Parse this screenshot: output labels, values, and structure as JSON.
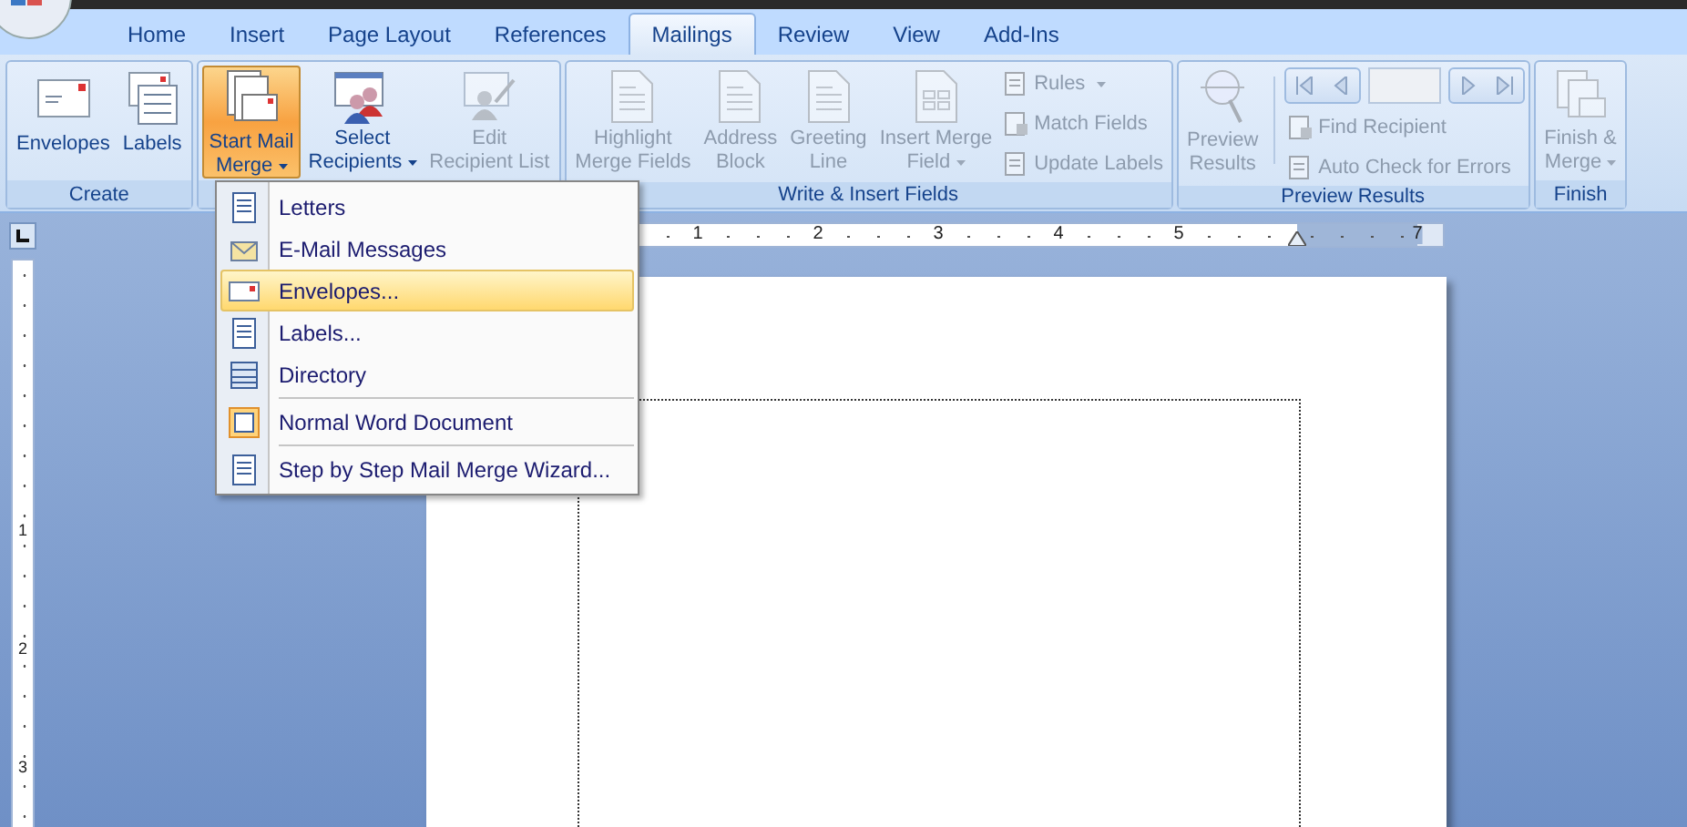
{
  "tabs": [
    {
      "label": "Home",
      "selected": false
    },
    {
      "label": "Insert",
      "selected": false
    },
    {
      "label": "Page Layout",
      "selected": false
    },
    {
      "label": "References",
      "selected": false
    },
    {
      "label": "Mailings",
      "selected": true
    },
    {
      "label": "Review",
      "selected": false
    },
    {
      "label": "View",
      "selected": false
    },
    {
      "label": "Add-Ins",
      "selected": false
    }
  ],
  "ribbon": {
    "groups": [
      {
        "label": "Create",
        "items": [
          {
            "kind": "large",
            "lines": [
              "Envelopes"
            ],
            "disabled": false,
            "pressed": false,
            "dropdown": false
          },
          {
            "kind": "large",
            "lines": [
              "Labels"
            ],
            "disabled": false,
            "pressed": false,
            "dropdown": false
          }
        ]
      },
      {
        "items": [
          {
            "kind": "large",
            "lines": [
              "Start Mail",
              "Merge"
            ],
            "disabled": false,
            "pressed": true,
            "dropdown": true
          },
          {
            "kind": "large",
            "lines": [
              "Select",
              "Recipients"
            ],
            "disabled": false,
            "pressed": false,
            "dropdown": true
          },
          {
            "kind": "large",
            "lines": [
              "Edit",
              "Recipient List"
            ],
            "disabled": true,
            "pressed": false,
            "dropdown": false
          }
        ]
      },
      {
        "label": "Write & Insert Fields",
        "items": [
          {
            "kind": "large",
            "lines": [
              "Highlight",
              "Merge Fields"
            ],
            "disabled": true,
            "pressed": false,
            "dropdown": false
          },
          {
            "kind": "large",
            "lines": [
              "Address",
              "Block"
            ],
            "disabled": true,
            "pressed": false,
            "dropdown": false
          },
          {
            "kind": "large",
            "lines": [
              "Greeting",
              "Line"
            ],
            "disabled": true,
            "pressed": false,
            "dropdown": false
          },
          {
            "kind": "large",
            "lines": [
              "Insert Merge",
              "Field"
            ],
            "disabled": true,
            "pressed": false,
            "dropdown": true
          },
          {
            "kind": "small",
            "labels": [
              "Rules",
              "Match Fields",
              "Update Labels"
            ],
            "dropdowns": [
              true,
              false,
              false
            ],
            "disabled": true
          }
        ]
      },
      {
        "label": "Preview Results",
        "items": [
          {
            "kind": "large",
            "lines": [
              "Preview",
              "Results"
            ],
            "disabled": true,
            "pressed": false,
            "dropdown": false
          },
          {
            "kind": "nav",
            "labels": [
              "Find Recipient",
              "Auto Check for Errors"
            ],
            "dropdowns": [
              false,
              false
            ],
            "disabled": true
          }
        ]
      },
      {
        "label": "Finish",
        "items": [
          {
            "kind": "large",
            "lines": [
              "Finish &",
              "Merge"
            ],
            "disabled": true,
            "pressed": false,
            "dropdown": true
          }
        ]
      }
    ]
  },
  "menu": {
    "sections": [
      {
        "items": [
          {
            "label": "Letters",
            "selected": false
          },
          {
            "label": "E-Mail Messages",
            "selected": false
          },
          {
            "label": "Envelopes...",
            "selected": true
          },
          {
            "label": "Labels...",
            "selected": false
          },
          {
            "label": "Directory",
            "selected": false
          }
        ]
      },
      {
        "items": [
          {
            "label": "Normal Word Document",
            "selected": false
          }
        ]
      },
      {
        "items": [
          {
            "label": "Step by Step Mail Merge Wizard...",
            "selected": false
          }
        ]
      }
    ]
  },
  "ruler": {
    "numbers": [
      "1",
      "2",
      "3",
      "4",
      "5",
      "7"
    ]
  },
  "vertical_ruler": {
    "numbers": [
      "1",
      "2",
      "3"
    ]
  }
}
